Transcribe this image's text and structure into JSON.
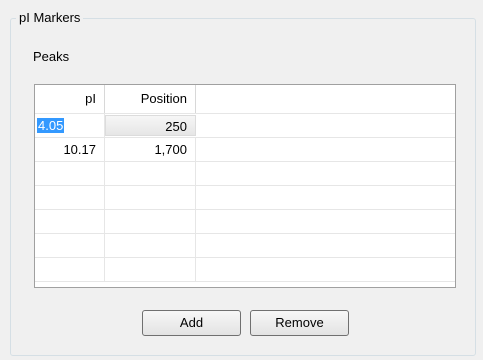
{
  "group": {
    "title": "pI Markers"
  },
  "section": {
    "label": "Peaks"
  },
  "table": {
    "columns": [
      "pI",
      "Position",
      ""
    ],
    "rows": [
      [
        "4.05",
        "250",
        ""
      ],
      [
        "10.17",
        "1,700",
        ""
      ],
      [
        "",
        "",
        ""
      ],
      [
        "",
        "",
        ""
      ],
      [
        "",
        "",
        ""
      ],
      [
        "",
        "",
        ""
      ],
      [
        "",
        "",
        ""
      ]
    ]
  },
  "buttons": {
    "add": "Add",
    "remove": "Remove"
  }
}
